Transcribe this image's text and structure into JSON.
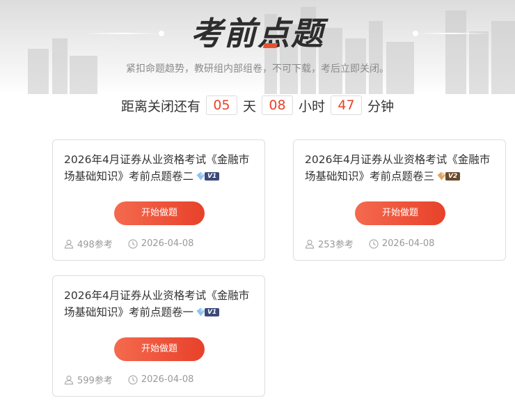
{
  "header": {
    "title_part1": "考前",
    "title_part2": "点",
    "title_part3": "题",
    "subtitle": "紧扣命题趋势，教研组内部组卷，不可下载，考后立即关闭。"
  },
  "countdown": {
    "prefix": "距离关闭还有",
    "days": "05",
    "days_unit": "天",
    "hours": "08",
    "hours_unit": "小时",
    "minutes": "47",
    "minutes_unit": "分钟"
  },
  "cards": [
    {
      "title": "2026年4月证券从业资格考试《金融市场基础知识》考前点题卷二",
      "badge": "V1",
      "button": "开始做题",
      "participants": "498参考",
      "date": "2026-04-08"
    },
    {
      "title": "2026年4月证券从业资格考试《金融市场基础知识》考前点题卷三",
      "badge": "V2",
      "button": "开始做题",
      "participants": "253参考",
      "date": "2026-04-08"
    },
    {
      "title": "2026年4月证券从业资格考试《金融市场基础知识》考前点题卷一",
      "badge": "V1",
      "button": "开始做题",
      "participants": "599参考",
      "date": "2026-04-08"
    }
  ],
  "colors": {
    "accent": "#e8412a",
    "button_start": "#f46a4e",
    "badge_v1": "#3c4a7a",
    "badge_v2": "#6b4a2a"
  },
  "icons": {
    "participants": "user-icon",
    "date": "clock-icon",
    "badge_v1": "blue-diamond-icon",
    "badge_v2": "gold-diamond-icon"
  }
}
